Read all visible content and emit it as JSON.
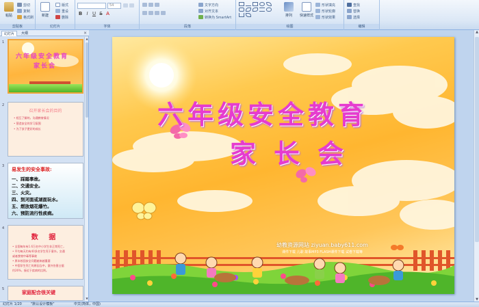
{
  "ribbon": {
    "clipboard": {
      "label": "剪贴板",
      "paste": "粘贴",
      "cut": "剪切",
      "copy": "复制",
      "format_painter": "格式刷"
    },
    "slides": {
      "label": "幻灯片",
      "new_slide": "新建",
      "new_slide_2": "幻灯片",
      "layout": "版式",
      "reset": "重设",
      "delete": "删除"
    },
    "font": {
      "label": "字体",
      "size": "54"
    },
    "paragraph": {
      "label": "段落",
      "text_direction": "文字方向",
      "align_text": "对齐文本",
      "smartart": "转换为 SmartArt"
    },
    "drawing": {
      "label": "绘图",
      "arrange": "排列",
      "quick_styles": "快速样式",
      "shape_fill": "形状填充",
      "shape_outline": "形状轮廓",
      "shape_effects": "形状效果"
    },
    "editing": {
      "label": "编辑",
      "find": "查找",
      "replace": "替换",
      "select": "选择"
    }
  },
  "panel": {
    "tab_slides": "幻灯片",
    "tab_outline": "大纲",
    "close": "×",
    "slide_numbers": [
      "1",
      "2",
      "3",
      "4",
      "5"
    ],
    "thumb1": {
      "title_line1": "六年级安全教育",
      "title_line2": "家长会"
    },
    "thumb2": {
      "heading": "召开家长会的目的",
      "bullets": [
        "• 相互了解的，沟通教育情况",
        "• 营造安全的学习氛围",
        "• 为了孩子更好的成长"
      ]
    },
    "thumb3": {
      "heading": "易发生的安全事故:",
      "items": [
        "一、踩踏事故。",
        "二、交通安全。",
        "三、火灾。",
        "四、到河面或湖面玩水。",
        "五、燃放烟花爆竹。",
        "六、预防流行性疾病。"
      ]
    },
    "thumb4": {
      "heading": "数 据",
      "bullets": [
        "• 全国每年有1.6万名中小学生非正常死亡，",
        "• 平均每天约有40多名学生死于意外。交通",
        "  或者食物中毒等事故",
        "• 原本校园安全问题越来越重要",
        "• 中国学生死亡的原因当中，意外伤害占据",
        "  约26%，接近于疾病的比例。"
      ]
    },
    "thumb5": {
      "heading": "家庭配合很关键"
    }
  },
  "slide": {
    "title_line1": "六年级安全教育",
    "title_line2": "家长会",
    "watermark_line1": "幼教资源网站  ziyuan.baby611.com",
    "watermark_line2": "课件下载  儿歌  故事MP3  FLASH课件下载  试卷下载等"
  },
  "status": {
    "slide_info": "幻灯片 1/20",
    "theme": "\"默认设计模板\"",
    "language": "中文(简体，中国)"
  },
  "colors": {
    "title": "#e63ccf",
    "ribbon_bg": "#dce8f6",
    "accent_selection": "#f0a43a"
  }
}
